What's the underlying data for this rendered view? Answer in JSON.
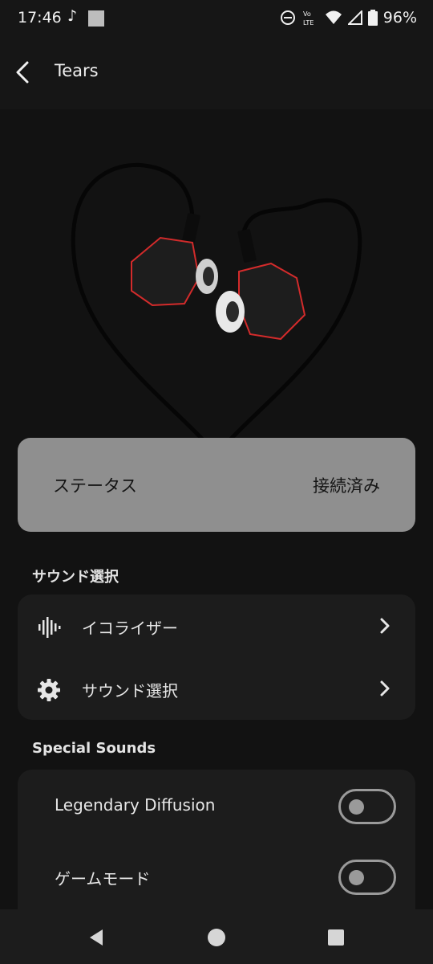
{
  "status_bar": {
    "time": "17:46",
    "battery": "96%",
    "icons": [
      "music-note-icon",
      "screenshot-icon",
      "dnd-icon",
      "volte-icon",
      "wifi-icon",
      "signal-icon",
      "battery-icon"
    ]
  },
  "app_bar": {
    "title": "Tears"
  },
  "device_status": {
    "label": "ステータス",
    "value": "接続済み"
  },
  "sound_section": {
    "title": "サウンド選択",
    "items": [
      {
        "label": "イコライザー",
        "icon": "equalizer-icon"
      },
      {
        "label": "サウンド選択",
        "icon": "gear-icon"
      }
    ]
  },
  "special_section": {
    "title": "Special Sounds",
    "toggles": [
      {
        "label": "Legendary Diffusion",
        "on": false
      },
      {
        "label": "ゲームモード",
        "on": false
      }
    ]
  },
  "colors": {
    "background": "#121212",
    "card": "#1c1c1c",
    "status_card": "#8f8f8f",
    "accent_red": "#d32b2b"
  }
}
